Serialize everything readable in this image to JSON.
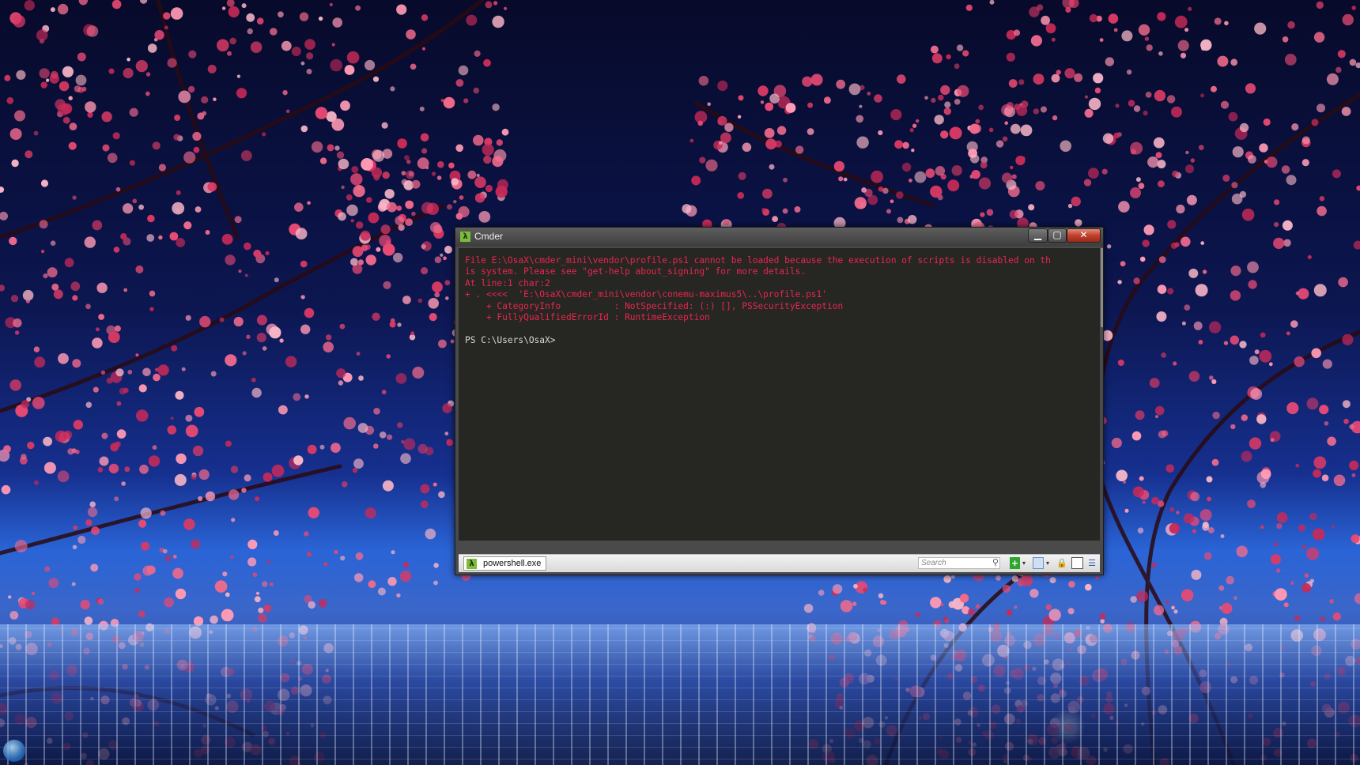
{
  "window": {
    "title": "Cmder",
    "app_icon": "λ",
    "controls": {
      "minimize": "▁",
      "maximize": "▢",
      "close": "✕"
    }
  },
  "terminal": {
    "error_lines": [
      "File E:\\OsaX\\cmder_mini\\vendor\\profile.ps1 cannot be loaded because the execution of scripts is disabled on th",
      "is system. Please see \"get-help about_signing\" for more details.",
      "At line:1 char:2",
      "+ . <<<<  'E:\\OsaX\\cmder_mini\\vendor\\conemu-maximus5\\..\\profile.ps1'",
      "    + CategoryInfo          : NotSpecified: (:) [], PSSecurityException",
      "    + FullyQualifiedErrorId : RuntimeException"
    ],
    "prompt": "PS C:\\Users\\OsaX>"
  },
  "status_bar": {
    "tab_label": "powershell.exe",
    "tab_icon": "λ",
    "search_placeholder": "Search",
    "search_icon": "⚲",
    "new_console": "+",
    "dropdown_arrow": "▾",
    "lock": "🔒",
    "menu": "☰"
  },
  "icons": [
    "lambda-icon",
    "search-icon",
    "add-icon",
    "lock-icon",
    "menu-icon"
  ],
  "colors": {
    "error_text": "#e9264e",
    "terminal_bg": "#262622",
    "accent_green": "#7bbd3b"
  }
}
